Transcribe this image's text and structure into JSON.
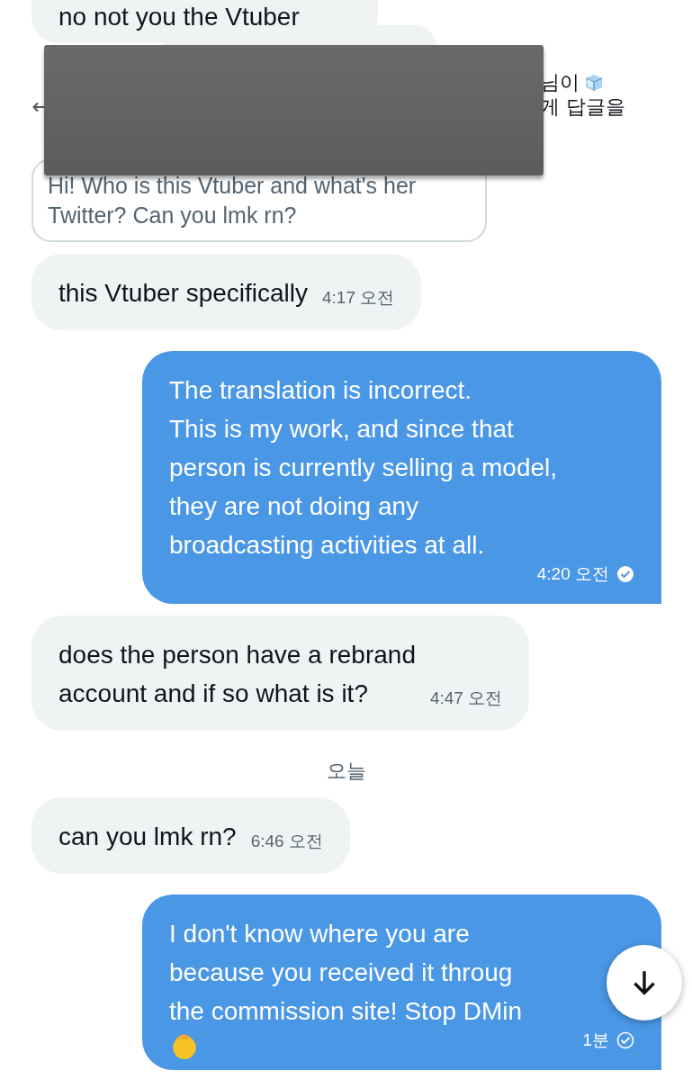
{
  "top_message": {
    "text": "no not you the Vtuber"
  },
  "reply_context": {
    "line_1": "님이",
    "line_2": "게 답글을"
  },
  "quoted_message": {
    "text": "Hi! Who is this Vtuber and what's her\nTwitter? Can you lmk rn?"
  },
  "messages": [
    {
      "kind": "received",
      "text": "this Vtuber specifically",
      "time": "4:17 오전"
    },
    {
      "kind": "sent",
      "text": "The translation is incorrect.\nThis is my work, and since that\nperson is currently selling a model,\nthey are not doing any\nbroadcasting activities at all.",
      "time": "4:20 오전",
      "read": true
    },
    {
      "kind": "received",
      "text": "does the person have a rebrand\naccount and if so what is it?",
      "time": "4:47 오전"
    },
    {
      "kind": "date",
      "text": "오늘"
    },
    {
      "kind": "received",
      "text": "can you lmk rn?",
      "time": "6:46 오전"
    },
    {
      "kind": "sent",
      "text": "I don't know where you are\nbecause you received it throug\nthe commission site! Stop DMin",
      "time": "1분",
      "read": false,
      "emoji": true
    }
  ]
}
